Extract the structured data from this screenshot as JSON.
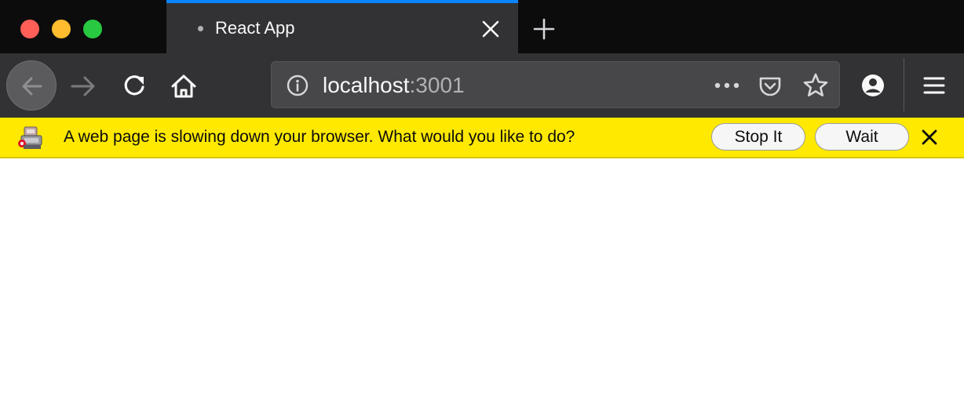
{
  "window": {
    "traffic_lights": {
      "close": "#ff5f57",
      "minimize": "#febc2e",
      "zoom": "#28c840"
    }
  },
  "tab": {
    "title": "React App",
    "accent": "#0a84ff",
    "icons": {
      "status": "tab-loading-dot",
      "close": "close-icon",
      "new_tab": "plus-icon"
    }
  },
  "toolbar": {
    "icons": {
      "back": "back-arrow-icon",
      "forward": "forward-arrow-icon",
      "reload": "reload-icon",
      "home": "home-icon",
      "account": "account-icon",
      "menu": "hamburger-menu-icon"
    }
  },
  "urlbar": {
    "host": "localhost",
    "port": ":3001",
    "icons": {
      "info": "info-icon",
      "page_actions": "ellipsis-icon",
      "pocket": "pocket-icon",
      "bookmark": "star-icon"
    }
  },
  "notification": {
    "message": "A web page is slowing down your browser. What would you like to do?",
    "stop_label": "Stop It",
    "wait_label": "Wait",
    "background": "#ffe900",
    "icons": {
      "warning": "hung-script-icon",
      "close": "close-icon"
    }
  }
}
